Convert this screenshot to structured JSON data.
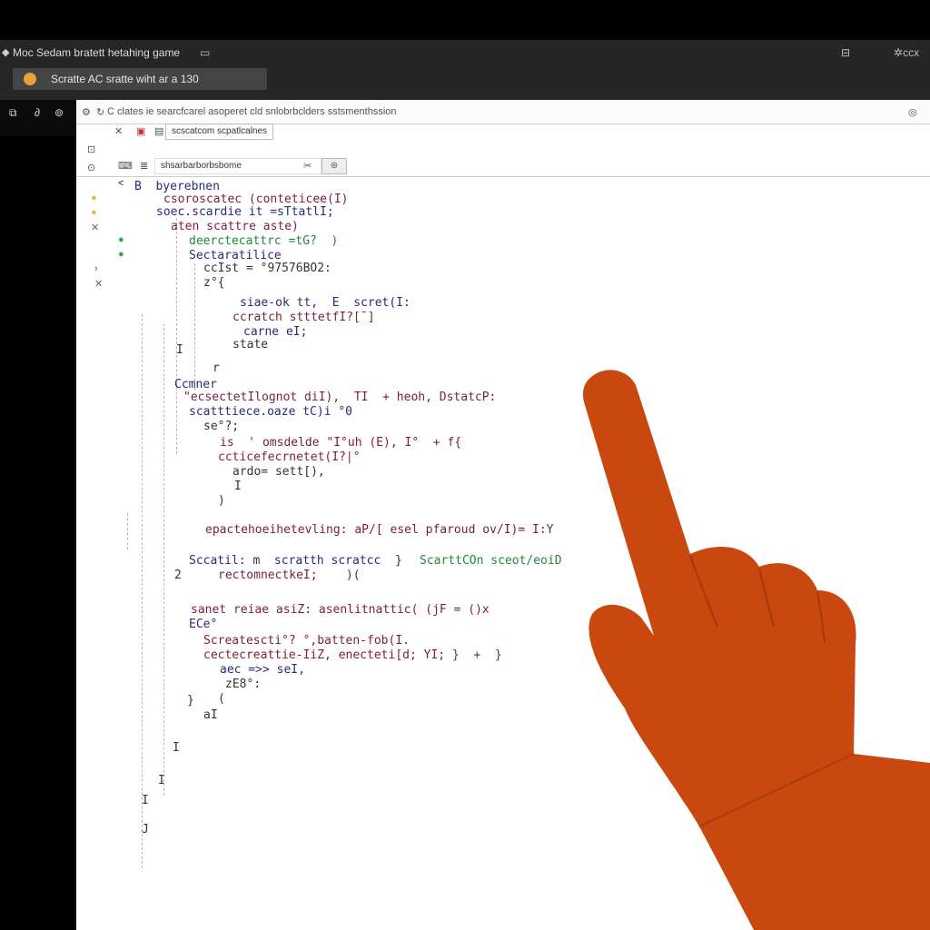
{
  "window": {
    "app_icon": "window-icon",
    "title": "Moc Sedam bratett hetahing game",
    "restore_icon": "restore-icon",
    "maximize_icon": "maximize-icon",
    "close_label": "ccx"
  },
  "tab": {
    "icon": "app-logo-icon",
    "label": "Scratte AC sratte wiht ar a 130"
  },
  "left_toolbar": [
    "back-icon",
    "forward-icon",
    "refresh-icon"
  ],
  "address_bar": {
    "text": "C clates ie searcfcarel asoperet cld snlobrbclders sstsmenthssion"
  },
  "ribbon": {
    "breadcrumb": "scscatcom scpatlcalnes",
    "search_value": "shsarbarborbsbome"
  },
  "gutter_icons": [
    {
      "name": "chevron-left-icon",
      "glyph": "<",
      "color": "#111"
    },
    {
      "name": "folder-icon",
      "glyph": "●",
      "color": "#f0b54a"
    },
    {
      "name": "folder-icon",
      "glyph": "●",
      "color": "#f0b54a"
    },
    {
      "name": "pin-icon",
      "glyph": "✕",
      "color": "#666"
    },
    {
      "name": "status-ok-icon",
      "glyph": "●",
      "color": "#2fa84f"
    },
    {
      "name": "status-ok-icon",
      "glyph": "●",
      "color": "#2fa84f"
    },
    {
      "name": "chevron-right-icon",
      "glyph": "›",
      "color": "#555"
    },
    {
      "name": "star-icon",
      "glyph": "✕",
      "color": "#666"
    }
  ],
  "code_lines": [
    {
      "text": "B  byerebnen",
      "color": "#2a2a7a"
    },
    {
      "text": "csoroscatec (conteticee(I)",
      "color": "#7a1f3a"
    },
    {
      "text": "soec.scardie it =sTtatlI;",
      "color": "#2a2a7a"
    },
    {
      "text": "aten scattre aste)",
      "color": "#7a1f3a"
    },
    {
      "text": "deerctecattrc =tG?  )",
      "color": "#1d8a3a"
    },
    {
      "text": "Sectaratilice",
      "color": "#2a2a7a"
    },
    {
      "text": "ccIst = °97576BO2:",
      "color": "#333333"
    },
    {
      "text": "z°{",
      "color": "#333333"
    },
    {
      "text": "siae-ok tt,  E  scret(I:",
      "color": "#2a2a7a"
    },
    {
      "text": "ccratch stttetfI?[ˉ]",
      "color": "#7a1f3a"
    },
    {
      "text": "carne eI;",
      "color": "#2a2a7a"
    },
    {
      "text": "state",
      "color": "#333333"
    },
    {
      "text": "I",
      "color": "#333333"
    },
    {
      "text": "r",
      "color": "#333333"
    },
    {
      "text": "Ccmner",
      "color": "#2a2a7a"
    },
    {
      "text": "\"ecsectetIlognot diI),  TI  + heoh, DstatcP:",
      "color": "#7a1f3a"
    },
    {
      "text": "scatttiece.oaze tC)i °0",
      "color": "#2a2a7a"
    },
    {
      "text": "se°?;",
      "color": "#333333"
    },
    {
      "text": "is  ' omsdelde \"I°uh (E), I°  + f{",
      "color": "#7a1f3a"
    },
    {
      "text": "ccticefecrnetet(I?|°",
      "color": "#7a1f3a"
    },
    {
      "text": "ardo= sett[),",
      "color": "#333333"
    },
    {
      "text": "I",
      "color": "#333333"
    },
    {
      "text": ")",
      "color": "#333333"
    },
    {
      "text": "epactehoeihetevling: aP/[ esel pfaroud ov/I)= I:Y",
      "color": "#7a1f3a"
    },
    {
      "text": "Sccatil: m  scratth scratcc  }",
      "color": "#2a2a7a"
    },
    {
      "text": "ScarttCOn sceot/eoiD",
      "color": "#1d8a3a"
    },
    {
      "text": "2",
      "color": "#2a2a7a"
    },
    {
      "text": "rectomnectkeI;    )(",
      "color": "#7a1f3a"
    },
    {
      "text": "sanet reiae asiZ: asenlitnattic( (jF = ()x",
      "color": "#7a1f3a"
    },
    {
      "text": "ECe°",
      "color": "#2a2a7a"
    },
    {
      "text": "Screatescti°? °,batten-fob(I.",
      "color": "#7a1f3a"
    },
    {
      "text": "cectecreattie-IiZ, enecteti[d; YI; }  +  }",
      "color": "#7a1f3a"
    },
    {
      "text": "aec =>> seI,",
      "color": "#2a2a7a"
    },
    {
      "text": "zE8°:",
      "color": "#333333"
    },
    {
      "text": "}",
      "color": "#2a2a7a"
    },
    {
      "text": "(",
      "color": "#333333"
    },
    {
      "text": "aI",
      "color": "#333333"
    },
    {
      "text": "I",
      "color": "#333333"
    },
    {
      "text": "I",
      "color": "#333333"
    },
    {
      "text": "I",
      "color": "#333333"
    },
    {
      "text": "J",
      "color": "#333333"
    }
  ],
  "hand": {
    "icon": "pointing-hand",
    "color": "#c9480f"
  }
}
